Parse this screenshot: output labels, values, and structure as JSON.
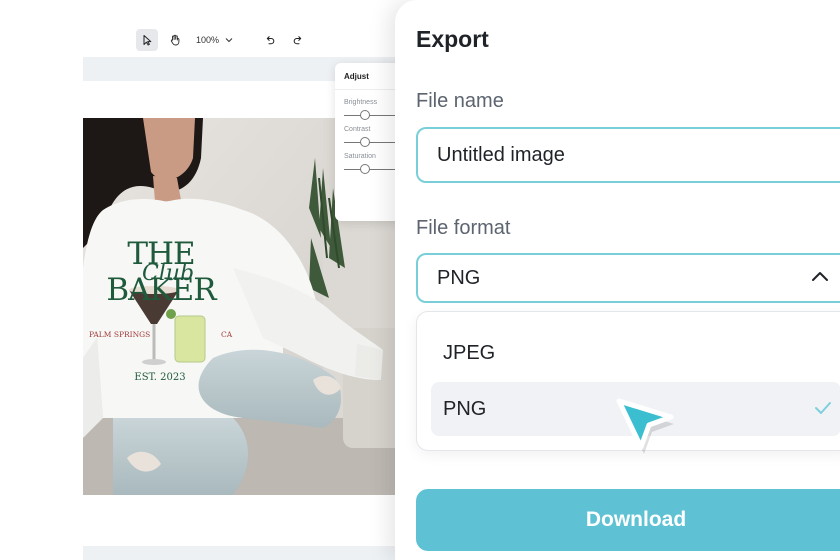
{
  "toolbar": {
    "zoom": "100%",
    "icons": [
      "pointer-icon",
      "hand-icon",
      "chevron-down-icon",
      "undo-icon",
      "redo-icon"
    ]
  },
  "adjust": {
    "title": "Adjust",
    "sliders": [
      {
        "label": "Brightness",
        "value": 0.35
      },
      {
        "label": "Contrast",
        "value": 0.35
      },
      {
        "label": "Saturation",
        "value": 0.35
      }
    ]
  },
  "photo": {
    "sweatshirt_lines": [
      "THE BAKER",
      "Club",
      "PALM SPRINGS",
      "CA",
      "EST. 2023"
    ]
  },
  "export": {
    "title": "Export",
    "file_name_label": "File name",
    "file_name_value": "Untitled image",
    "file_format_label": "File format",
    "selected_format": "PNG",
    "options": [
      "JPEG",
      "PNG"
    ],
    "download_label": "Download"
  },
  "colors": {
    "accent": "#5ec2d4",
    "input_border": "#79cfd9",
    "check": "#7fd0dd",
    "cursor": "#3bbfd0"
  }
}
